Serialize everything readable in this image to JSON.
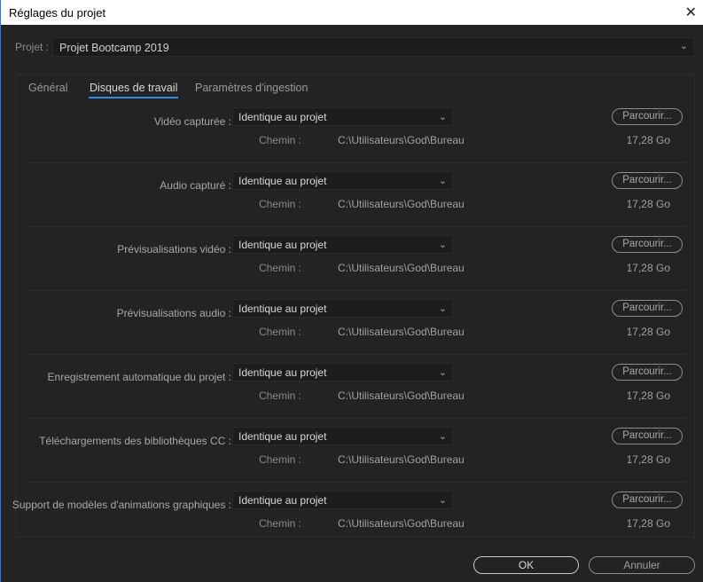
{
  "window": {
    "title": "Réglages du projet",
    "close": "✕"
  },
  "project": {
    "label": "Projet :",
    "value": "Projet Bootcamp 2019"
  },
  "tabs": [
    {
      "label": "Général"
    },
    {
      "label": "Disques de travail"
    },
    {
      "label": "Paramètres d'ingestion"
    }
  ],
  "active_tab": "Disques de travail",
  "rows": [
    {
      "label": "Vidéo capturée :",
      "value": "Identique au projet",
      "browse": "Parcourir...",
      "path_label": "Chemin :",
      "path": "C:\\Utilisateurs\\God\\Bureau",
      "size": "17,28 Go"
    },
    {
      "label": "Audio capturé :",
      "value": "Identique au projet",
      "browse": "Parcourir...",
      "path_label": "Chemin :",
      "path": "C:\\Utilisateurs\\God\\Bureau",
      "size": "17,28 Go"
    },
    {
      "label": "Prévisualisations vidéo :",
      "value": "Identique au projet",
      "browse": "Parcourir...",
      "path_label": "Chemin :",
      "path": "C:\\Utilisateurs\\God\\Bureau",
      "size": "17,28 Go"
    },
    {
      "label": "Prévisualisations audio :",
      "value": "Identique au projet",
      "browse": "Parcourir...",
      "path_label": "Chemin :",
      "path": "C:\\Utilisateurs\\God\\Bureau",
      "size": "17,28 Go"
    },
    {
      "label": "Enregistrement automatique du projet :",
      "value": "Identique au projet",
      "browse": "Parcourir...",
      "path_label": "Chemin :",
      "path": "C:\\Utilisateurs\\God\\Bureau",
      "size": "17,28 Go"
    },
    {
      "label": "Téléchargements des bibliothèques CC :",
      "value": "Identique au projet",
      "browse": "Parcourir...",
      "path_label": "Chemin :",
      "path": "C:\\Utilisateurs\\God\\Bureau",
      "size": "17,28 Go"
    },
    {
      "label": "Support de modèles d'animations graphiques :",
      "value": "Identique au projet",
      "browse": "Parcourir...",
      "path_label": "Chemin :",
      "path": "C:\\Utilisateurs\\God\\Bureau",
      "size": "17,28 Go"
    }
  ],
  "buttons": {
    "ok": "OK",
    "cancel": "Annuler"
  },
  "colors": {
    "accent": "#2d8ceb",
    "background": "#232323"
  }
}
